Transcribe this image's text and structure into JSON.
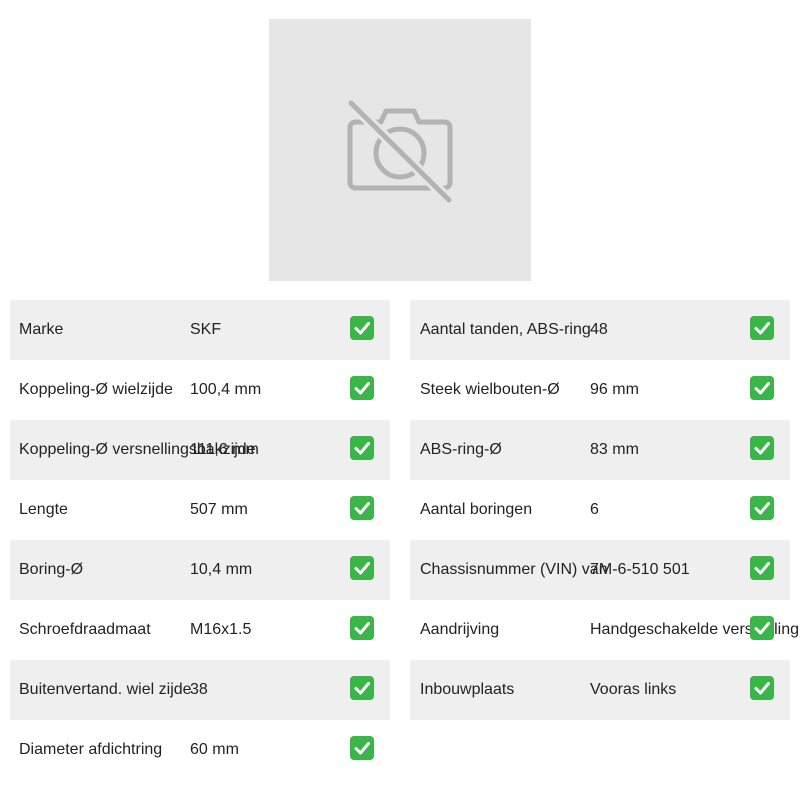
{
  "image": {
    "icon": "no-photo-camera-icon",
    "background": "#e6e6e6"
  },
  "specs_left": [
    {
      "label": "Marke",
      "value": "SKF"
    },
    {
      "label": "Koppeling-Ø wielzijde",
      "value": "100,4 mm"
    },
    {
      "label": "Koppeling-Ø versnellingsbakzijde",
      "value": "111,6 mm"
    },
    {
      "label": "Lengte",
      "value": "507 mm"
    },
    {
      "label": "Boring-Ø",
      "value": "10,4 mm"
    },
    {
      "label": "Schroefdraadmaat",
      "value": "M16x1.5"
    },
    {
      "label": "Buitenvertand. wiel zijde",
      "value": "38"
    },
    {
      "label": "Diameter afdichtring",
      "value": "60 mm"
    }
  ],
  "specs_right": [
    {
      "label": "Aantal tanden, ABS-ring",
      "value": "48"
    },
    {
      "label": "Steek wielbouten-Ø",
      "value": "96 mm"
    },
    {
      "label": "ABS-ring-Ø",
      "value": "83 mm"
    },
    {
      "label": "Aantal boringen",
      "value": "6"
    },
    {
      "label": "Chassisnummer (VIN) van",
      "value": "7M-6-510 501"
    },
    {
      "label": "Aandrijving",
      "value": "Handgeschakelde versnelling"
    },
    {
      "label": "Inbouwplaats",
      "value": "Vooras links"
    }
  ],
  "check_icon": "check-mark-button-icon",
  "colors": {
    "row_shade": "#efefef",
    "check_green": "#39b54a"
  }
}
